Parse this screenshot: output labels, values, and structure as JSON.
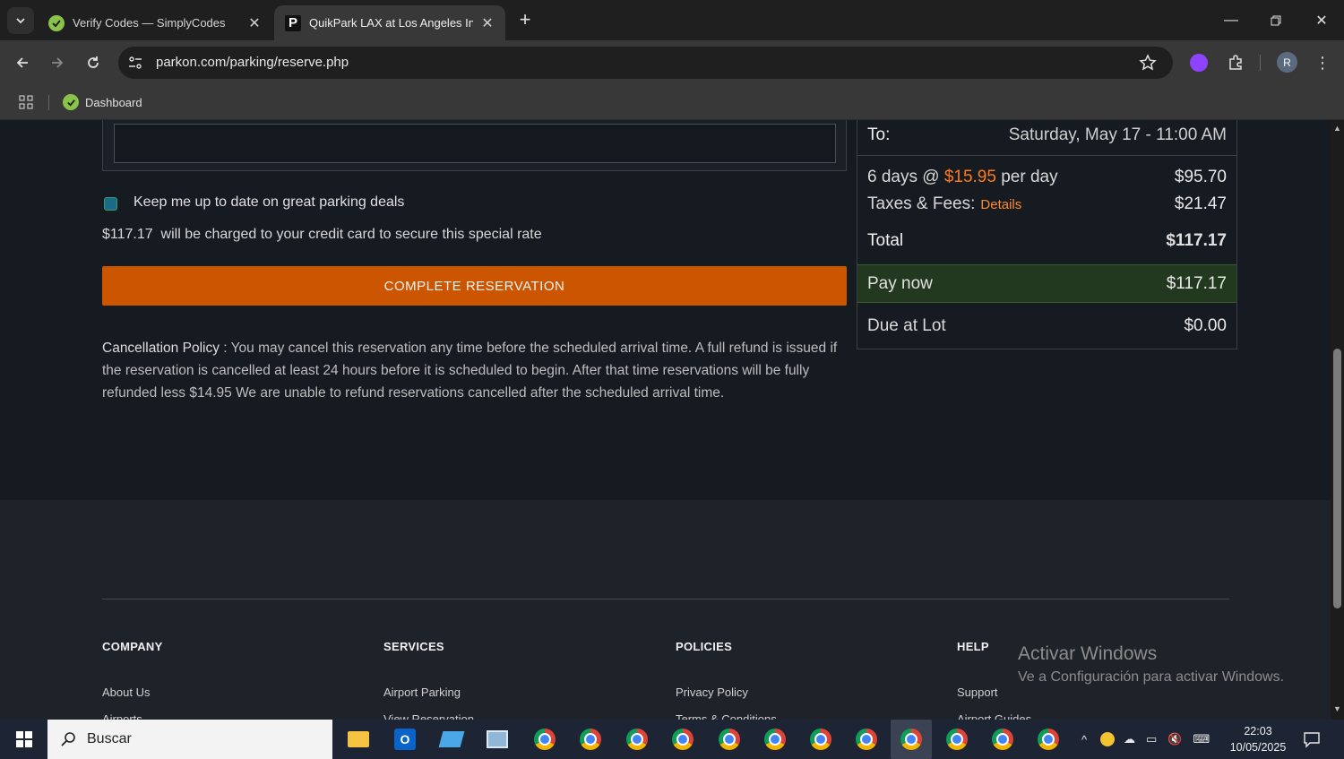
{
  "browser": {
    "tabs": [
      {
        "title": "Verify Codes — SimplyCodes",
        "active": false
      },
      {
        "title": "QuikPark LAX at Los Angeles Int",
        "active": true
      }
    ],
    "url": "parkon.com/parking/reserve.php",
    "bookmarks": [
      {
        "label": "Dashboard"
      }
    ],
    "profile_initial": "R"
  },
  "form": {
    "keep_updated_label": "Keep me up to date on great parking deals",
    "charge_amount": "$117.17",
    "charge_text": "will be charged to your credit card to secure this special rate",
    "complete_button": "COMPLETE  RESERVATION",
    "policy_heading": "Cancellation Policy",
    "policy_text": " : You may cancel this reservation any time before the scheduled arrival time. A full refund is issued if the reservation is cancelled at least 24 hours before it is scheduled to begin. After that time reservations will be fully refunded less $14.95 We are unable to refund reservations cancelled after the scheduled arrival time."
  },
  "summary": {
    "to_label": "To:",
    "to_value": "Saturday, May 17 - 11:00 AM",
    "days_prefix": "6 days @ ",
    "daily_rate": "$15.95",
    "days_suffix": " per day",
    "subtotal": "$95.70",
    "taxes_label": "Taxes & Fees:",
    "details_link": "Details",
    "taxes_value": "$21.47",
    "total_label": "Total",
    "total_value": "$117.17",
    "pay_now_label": "Pay now",
    "pay_now_value": "$117.17",
    "due_label": "Due at Lot",
    "due_value": "$0.00"
  },
  "footer": {
    "columns": [
      {
        "heading": "COMPANY",
        "links": [
          "About Us",
          "Airports"
        ]
      },
      {
        "heading": "SERVICES",
        "links": [
          "Airport Parking",
          "View Reservation"
        ]
      },
      {
        "heading": "POLICIES",
        "links": [
          "Privacy Policy",
          "Terms & Conditions"
        ]
      },
      {
        "heading": "HELP",
        "links": [
          "Support",
          "Airport Guides"
        ]
      }
    ]
  },
  "watermark": {
    "line1": "Activar Windows",
    "line2": "Ve a Configuración para activar Windows."
  },
  "taskbar": {
    "search_placeholder": "Buscar",
    "time": "22:03",
    "date": "10/05/2025"
  },
  "colors": {
    "accent_orange": "#cc5500",
    "pay_now_bg": "#23391f",
    "page_bg": "#161b22"
  }
}
